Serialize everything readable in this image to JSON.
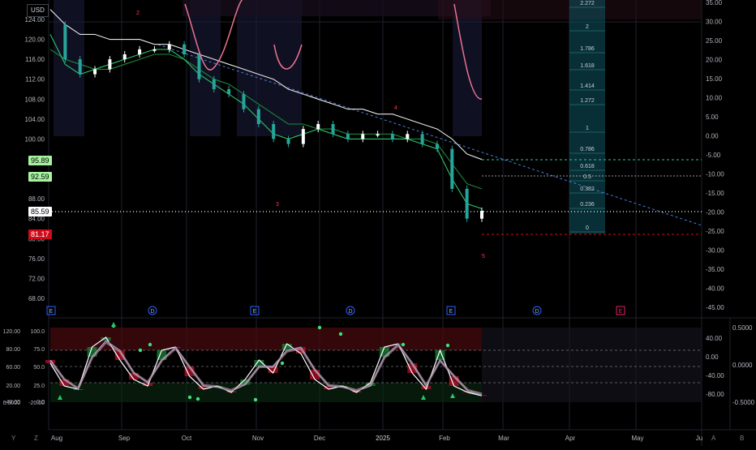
{
  "currency": "USD",
  "colors": {
    "background": "#000000",
    "grid": "#1e222d",
    "candle_up": "#ffffff",
    "candle_down": "#26a69a",
    "ema_slow": "#e6e6e6",
    "ema_mid": "#1b8a3a",
    "ema_fast": "#2bc46a",
    "pink": "#e8738f",
    "trend_dashed": "#4a7fd6",
    "fib_bg": "#0f5560",
    "price_tag": "#ffffff",
    "green_tag": "#a7f3a0",
    "red_tag": "#d10a1a"
  },
  "chart_data": [
    {
      "type": "line",
      "title": "",
      "price_axis_labels": [
        "124.00",
        "120.00",
        "116.00",
        "112.00",
        "108.00",
        "104.00",
        "100.00",
        "88.00",
        "84.00",
        "80.00",
        "76.00",
        "72.00",
        "68.00"
      ],
      "right_axis_labels": [
        "35.00",
        "30.00",
        "25.00",
        "20.00",
        "15.00",
        "10.00",
        "5.00",
        "0.00",
        "-5.00",
        "-10.00",
        "-15.00",
        "-20.00",
        "-25.00",
        "-30.00",
        "-35.00",
        "-40.00",
        "-45.00"
      ],
      "time_labels": [
        "Aug",
        "Sep",
        "Oct",
        "Nov",
        "Dec",
        "2025",
        "Feb",
        "Mar",
        "Apr",
        "May",
        "Ju"
      ],
      "price_tags": [
        {
          "label": "95.89",
          "kind": "green"
        },
        {
          "label": "92.59",
          "kind": "green"
        },
        {
          "label": "85.59",
          "kind": "white"
        },
        {
          "label": "81.17",
          "kind": "red"
        }
      ],
      "fib_levels": [
        "2.272",
        "2",
        "1.786",
        "1.618",
        "1.414",
        "1.272",
        "1",
        "0.786",
        "0.618",
        "0.5",
        "0.382",
        "0.236",
        "0"
      ],
      "wave_labels": [
        "2",
        "3",
        "4",
        "5"
      ],
      "event_markers": [
        "E",
        "D",
        "E",
        "D",
        "E",
        "D",
        "E"
      ],
      "series": [
        {
          "name": "price",
          "x": [
            "Jul 29",
            "Aug 5",
            "Aug 12",
            "Aug 19",
            "Aug 26",
            "Sep 2",
            "Sep 9",
            "Sep 16",
            "Sep 23",
            "Sep 30",
            "Oct 7",
            "Oct 14",
            "Oct 21",
            "Oct 28",
            "Nov 4",
            "Nov 11",
            "Nov 18",
            "Nov 25",
            "Dec 2",
            "Dec 9",
            "Dec 16",
            "Dec 23",
            "Dec 30",
            "Jan 6",
            "Jan 13",
            "Jan 20",
            "Jan 27",
            "Feb 3",
            "Feb 10",
            "Feb 17"
          ],
          "values": [
            123,
            116,
            113,
            114,
            116,
            117,
            118,
            118,
            119,
            117,
            112,
            110,
            109,
            106,
            103,
            100,
            99,
            102,
            103,
            101,
            100,
            101,
            101,
            100,
            101,
            99,
            98,
            90,
            84,
            85.59
          ]
        },
        {
          "name": "ema_slow",
          "values": [
            126,
            123,
            121,
            121,
            120,
            120,
            120,
            119,
            119,
            118,
            117,
            116,
            115,
            114,
            113,
            112,
            110,
            109,
            108,
            107,
            106,
            106,
            105,
            105,
            104,
            103,
            102,
            100,
            97,
            95.89
          ]
        },
        {
          "name": "ema_mid",
          "values": [
            118,
            116,
            115,
            114,
            114,
            115,
            116,
            117,
            117,
            116,
            114,
            112,
            111,
            109,
            107,
            105,
            103,
            103,
            102,
            102,
            101,
            101,
            101,
            101,
            100,
            100,
            99,
            95,
            91,
            90
          ]
        },
        {
          "name": "ema_fast",
          "values": [
            121,
            115,
            113,
            114,
            115,
            116,
            117,
            118,
            118,
            116,
            113,
            111,
            109,
            107,
            104,
            101,
            100,
            101,
            102,
            101,
            100,
            100,
            100,
            100,
            100,
            99,
            98,
            92,
            87,
            86
          ]
        }
      ],
      "ylim": [
        66,
        126
      ]
    },
    {
      "type": "line",
      "title": "",
      "left_axis_labels": [
        "120.00",
        "100.0",
        "80.00",
        "75.0",
        "60.00",
        "50.0",
        "20.00",
        "25.0",
        "0.0000",
        "-20.00",
        "0.0",
        "-40.00"
      ],
      "right_axis_labels": [
        "40.00",
        "0.00",
        "-40.00",
        "-80.00"
      ],
      "far_right_labels": [
        "0.5000",
        "0.0000",
        "-0.5000"
      ],
      "levels": [
        75,
        50,
        25
      ],
      "series": [
        {
          "name": "osc_main",
          "values": [
            55,
            20,
            15,
            80,
            95,
            60,
            30,
            20,
            75,
            80,
            35,
            15,
            20,
            10,
            30,
            60,
            40,
            85,
            70,
            30,
            15,
            20,
            10,
            25,
            80,
            85,
            40,
            15,
            75,
            20,
            10,
            5
          ]
        },
        {
          "name": "osc_signal",
          "values": [
            60,
            30,
            15,
            65,
            90,
            75,
            40,
            25,
            60,
            80,
            50,
            20,
            18,
            12,
            22,
            50,
            50,
            75,
            80,
            45,
            20,
            18,
            12,
            20,
            65,
            85,
            55,
            20,
            60,
            35,
            12,
            6
          ]
        }
      ],
      "ylim": [
        -10,
        110
      ]
    }
  ]
}
